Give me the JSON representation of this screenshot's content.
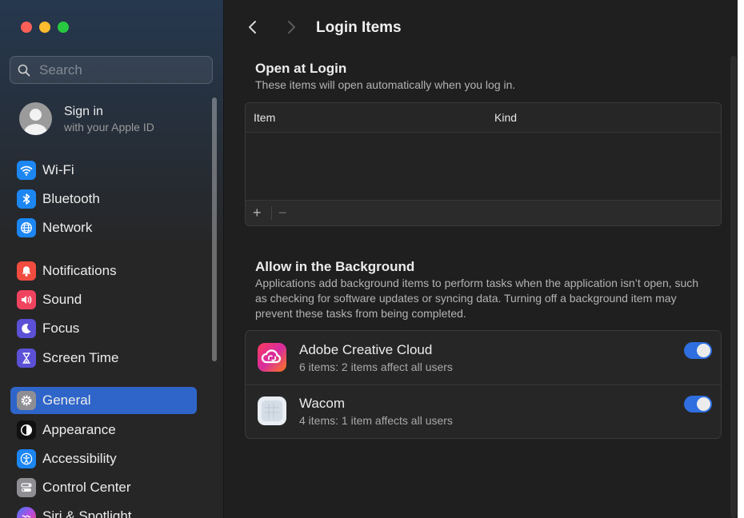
{
  "window": {
    "title": "Login Items"
  },
  "search": {
    "placeholder": "Search"
  },
  "account": {
    "title": "Sign in",
    "subtitle": "with your Apple ID"
  },
  "sidebar": {
    "items": [
      {
        "label": "Wi-Fi",
        "icon": "wifi-icon",
        "color": "#1c86f2"
      },
      {
        "label": "Bluetooth",
        "icon": "bluetooth-icon",
        "color": "#1c86f2"
      },
      {
        "label": "Network",
        "icon": "globe-icon",
        "color": "#1c86f2"
      },
      {
        "label": "Notifications",
        "icon": "bell-icon",
        "color": "#f14c3f"
      },
      {
        "label": "Sound",
        "icon": "speaker-icon",
        "color": "#f0435f"
      },
      {
        "label": "Focus",
        "icon": "moon-icon",
        "color": "#5b50d6"
      },
      {
        "label": "Screen Time",
        "icon": "hourglass-icon",
        "color": "#5b50d6"
      },
      {
        "label": "General",
        "icon": "gear-icon",
        "color": "#8e8e93",
        "selected": true
      },
      {
        "label": "Appearance",
        "icon": "appearance-icon",
        "color": "#111111"
      },
      {
        "label": "Accessibility",
        "icon": "accessibility-icon",
        "color": "#1c86f2"
      },
      {
        "label": "Control Center",
        "icon": "control-center-icon",
        "color": "#8e8e93"
      },
      {
        "label": "Siri & Spotlight",
        "icon": "siri-icon",
        "color": "#b04fe6"
      }
    ]
  },
  "open_at_login": {
    "title": "Open at Login",
    "description": "These items will open automatically when you log in.",
    "columns": [
      "Item",
      "Kind"
    ],
    "add_label": "+",
    "remove_label": "−"
  },
  "background": {
    "title": "Allow in the Background",
    "description": "Applications add background items to perform tasks when the application isn’t open, such as checking for software updates or syncing data. Turning off a background item may prevent these tasks from being completed.",
    "items": [
      {
        "name": "Adobe Creative Cloud",
        "detail": "6 items: 2 items affect all users",
        "enabled": true,
        "icon": "adobe-creative-cloud-icon"
      },
      {
        "name": "Wacom",
        "detail": "4 items: 1 item affects all users",
        "enabled": true,
        "icon": "wacom-icon"
      }
    ]
  },
  "colors": {
    "accent": "#2f65c9",
    "toggle_on": "#2f6fe0"
  }
}
